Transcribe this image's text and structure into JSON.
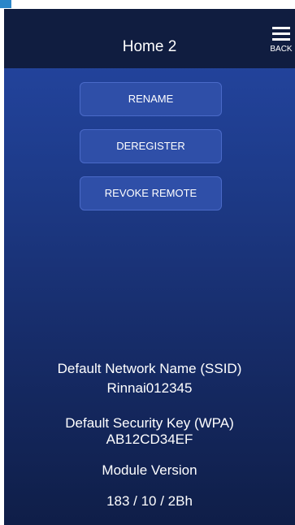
{
  "header": {
    "title": "Home 2",
    "back_label": "BACK",
    "back_icon": "hamburger-menu-icon"
  },
  "actions": [
    {
      "label": "RENAME"
    },
    {
      "label": "DEREGISTER"
    },
    {
      "label": "REVOKE REMOTE"
    }
  ],
  "info": {
    "ssid_label": "Default Network Name (SSID)",
    "ssid_value": "Rinnai012345",
    "wpa_label": "Default Security Key (WPA)",
    "wpa_value": "AB12CD34EF",
    "module_label": "Module Version",
    "module_value": "183 / 10 / 2Bh"
  },
  "colors": {
    "header_bg": "#101d40",
    "screen_gradient_top": "#2547a4",
    "screen_gradient_bottom": "#0f1e48",
    "button_bg": "#2f4fa8",
    "button_border": "#4a6ac8",
    "corner_accent": "#2a86c9"
  }
}
